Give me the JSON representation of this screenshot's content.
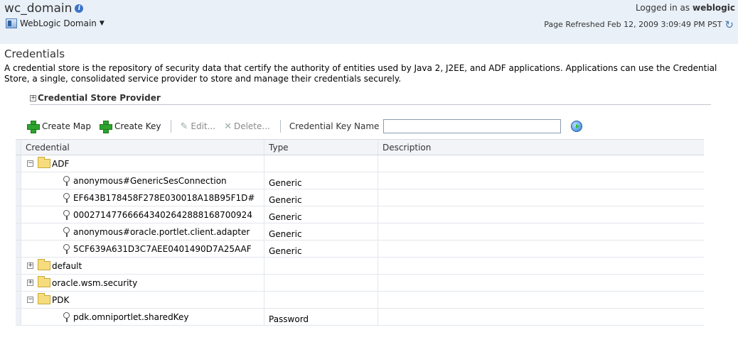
{
  "header": {
    "domain_title": "wc_domain",
    "login_prefix": "Logged in as",
    "login_user": "weblogic",
    "domain_menu_label": "WebLogic Domain",
    "refresh_text": "Page Refreshed Feb 12, 2009 3:09:49 PM PST"
  },
  "page": {
    "title": "Credentials",
    "description": "A credential store is the repository of security data that certify the authority of entities used by Java 2, J2EE, and ADF applications. Applications can use the Credential Store, a single, consolidated service provider to store and manage their credentials securely.",
    "provider_section": "Credential Store Provider"
  },
  "toolbar": {
    "create_map": "Create Map",
    "create_key": "Create Key",
    "edit": "Edit...",
    "delete": "Delete...",
    "key_name_label": "Credential Key Name",
    "key_name_value": ""
  },
  "table": {
    "columns": [
      "Credential",
      "Type",
      "Description"
    ],
    "rows": [
      {
        "kind": "folder",
        "expanded": true,
        "label": "ADF",
        "type": "",
        "description": ""
      },
      {
        "kind": "key",
        "label": "anonymous#GenericSesConnection",
        "type": "Generic",
        "description": ""
      },
      {
        "kind": "key",
        "label": "EF643B178458F278E030018A18B95F1D#",
        "type": "Generic",
        "description": ""
      },
      {
        "kind": "key",
        "label": "000271477666643402642888168700924",
        "type": "Generic",
        "description": ""
      },
      {
        "kind": "key",
        "label": "anonymous#oracle.portlet.client.adapter",
        "type": "Generic",
        "description": ""
      },
      {
        "kind": "key",
        "label": "5CF639A631D3C7AEE0401490D7A25AAF",
        "type": "Generic",
        "description": ""
      },
      {
        "kind": "folder",
        "expanded": false,
        "label": "default",
        "type": "",
        "description": ""
      },
      {
        "kind": "folder",
        "expanded": false,
        "label": "oracle.wsm.security",
        "type": "",
        "description": ""
      },
      {
        "kind": "folder",
        "expanded": true,
        "label": "PDK",
        "type": "",
        "description": ""
      },
      {
        "kind": "key",
        "label": "pdk.omniportlet.sharedKey",
        "type": "Password",
        "description": ""
      }
    ]
  },
  "colors": {
    "header_bg": "#e9f0f8",
    "folder_yellow": "#f7dc7d",
    "create_green": "#2ea32e"
  }
}
